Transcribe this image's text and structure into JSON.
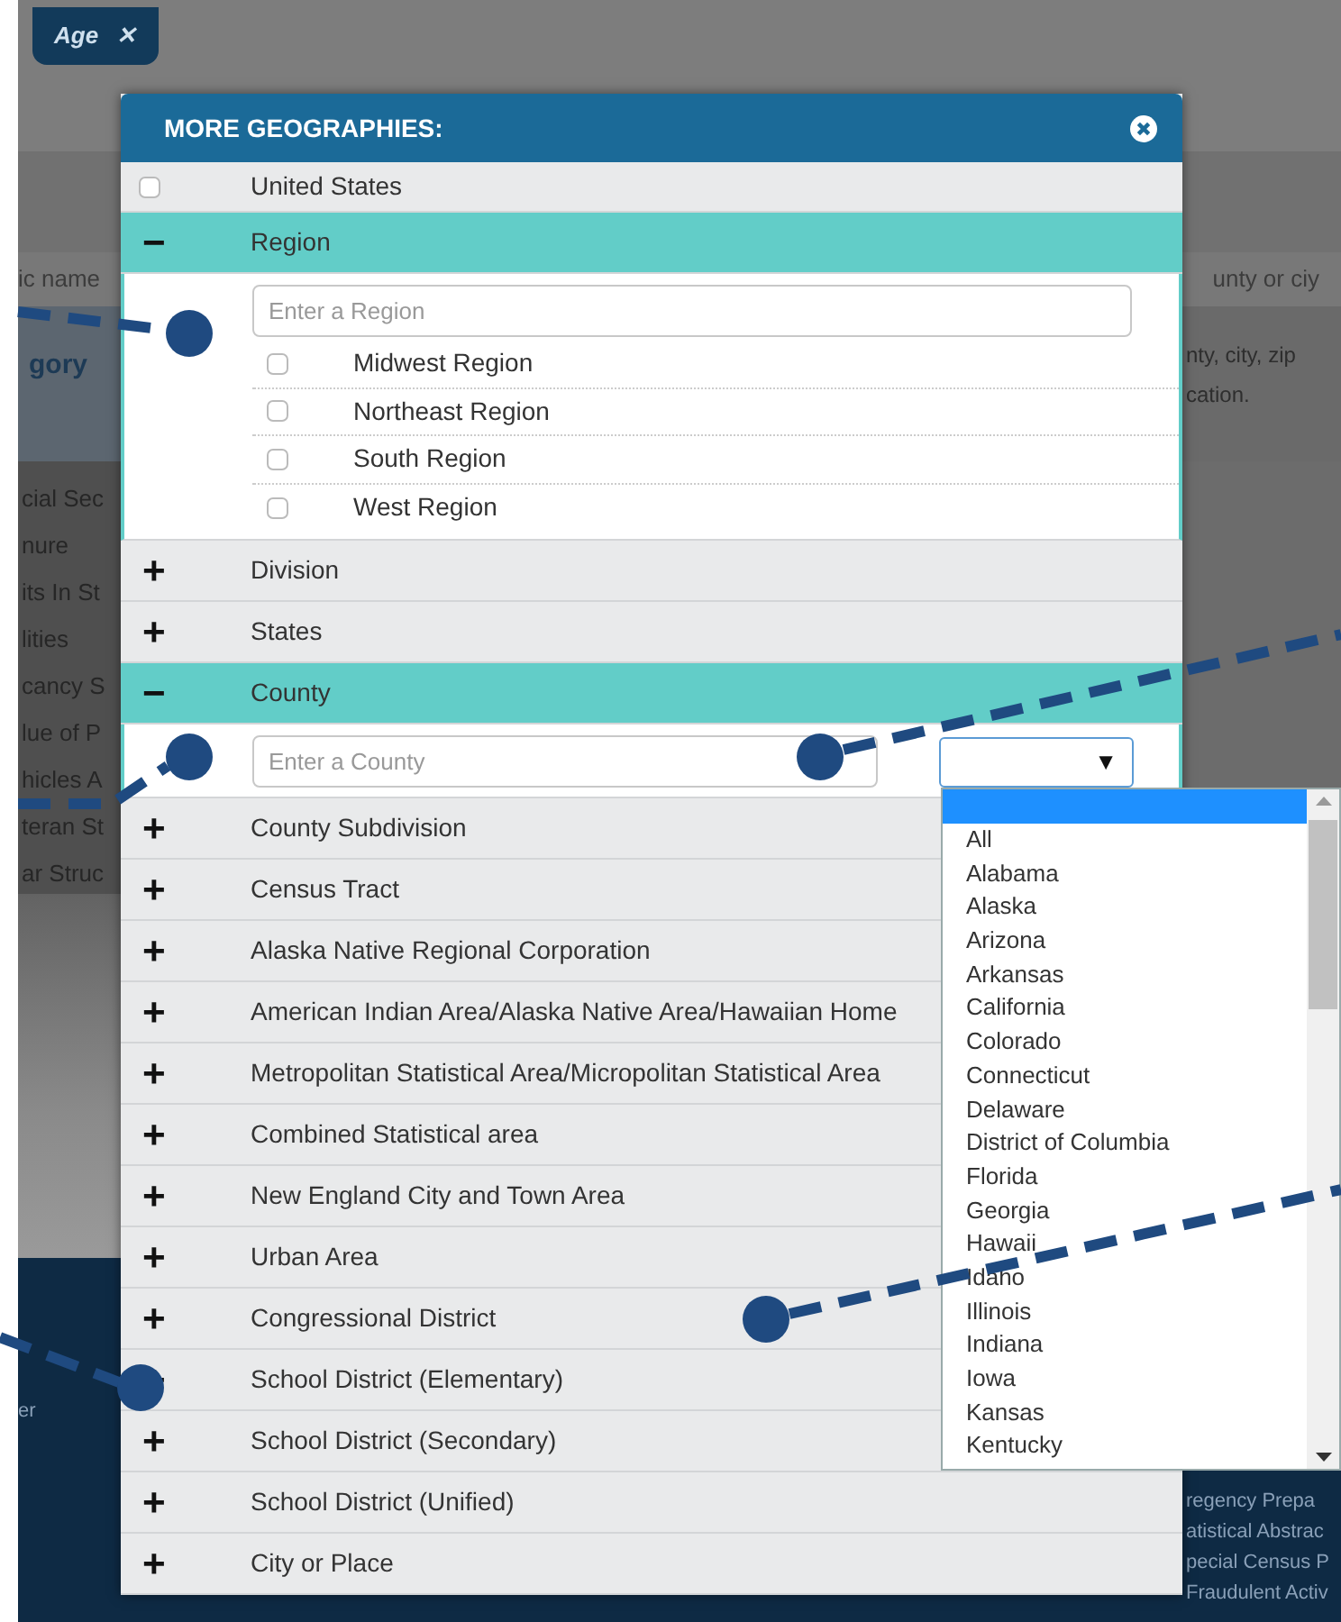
{
  "filter_tags": [
    {
      "label": "Age",
      "close": "✕"
    }
  ],
  "background": {
    "left_field": "ic name",
    "right_field": "unty or ciy",
    "left_heading": "gory",
    "right_help": [
      "nty, city, zip",
      "cation."
    ],
    "left_list": [
      "cial Sec",
      "nure",
      "its In St",
      "lities",
      "cancy S",
      "lue of P",
      "hicles A",
      "teran St",
      "ar Struc"
    ],
    "footer_left": "er",
    "footer_right": [
      "regency Prepa",
      "atistical Abstrac",
      "pecial Census P",
      "Fraudulent Activ"
    ]
  },
  "modal": {
    "title": "MORE GEOGRAPHIES:",
    "top_item": {
      "label": "United States",
      "checked": false
    },
    "levels": [
      {
        "label": "Region",
        "expanded": true,
        "search": {
          "placeholder": "Enter a Region"
        },
        "options": [
          {
            "label": "Midwest Region",
            "checked": false
          },
          {
            "label": "Northeast Region",
            "checked": false
          },
          {
            "label": "South Region",
            "checked": false
          },
          {
            "label": "West Region",
            "checked": false
          }
        ]
      },
      {
        "label": "Division",
        "expanded": false
      },
      {
        "label": "States",
        "expanded": false
      },
      {
        "label": "County",
        "expanded": true,
        "search": {
          "placeholder": "Enter a County"
        },
        "state_select": {
          "arrow": "▼",
          "open": true
        }
      },
      {
        "label": "County Subdivision",
        "expanded": false
      },
      {
        "label": "Census Tract",
        "expanded": false
      },
      {
        "label": "Alaska Native Regional Corporation",
        "expanded": false
      },
      {
        "label": "American Indian Area/Alaska Native Area/Hawaiian Home",
        "expanded": false
      },
      {
        "label": "Metropolitan Statistical Area/Micropolitan Statistical Area",
        "expanded": false
      },
      {
        "label": "Combined Statistical area",
        "expanded": false
      },
      {
        "label": "New England City and Town Area",
        "expanded": false
      },
      {
        "label": "Urban Area",
        "expanded": false
      },
      {
        "label": "Congressional District",
        "expanded": false
      },
      {
        "label": "School District (Elementary)",
        "expanded": false
      },
      {
        "label": "School District (Secondary)",
        "expanded": false
      },
      {
        "label": "School District (Unified)",
        "expanded": false
      },
      {
        "label": "City or Place",
        "expanded": false
      }
    ],
    "expand_symbols": {
      "collapsed": "+",
      "expanded": "−"
    }
  },
  "state_dropdown": {
    "blank_highlighted": true,
    "items": [
      "All",
      "Alabama",
      "Alaska",
      "Arizona",
      "Arkansas",
      "California",
      "Colorado",
      "Connecticut",
      "Delaware",
      "District of Columbia",
      "Florida",
      "Georgia",
      "Hawaii",
      "Idaho",
      "Illinois",
      "Indiana",
      "Iowa",
      "Kansas",
      "Kentucky"
    ]
  }
}
